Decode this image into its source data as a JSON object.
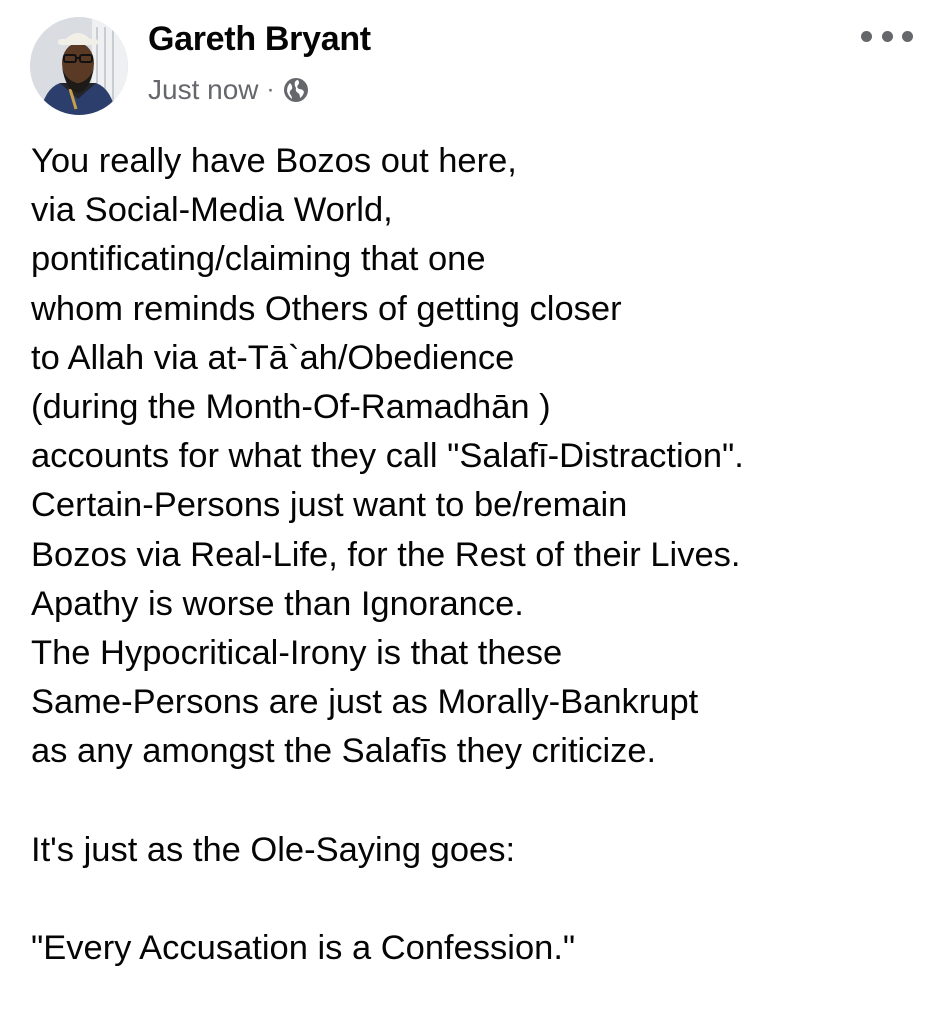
{
  "post": {
    "author": "Gareth Bryant",
    "timestamp": "Just now",
    "separator": "·",
    "privacy_icon": "globe-icon",
    "avatar": "profile-photo",
    "more_icon": "more-options-icon",
    "lines": [
      "You really have Bozos out here,",
      "via Social-Media World,",
      "pontificating/claiming that one",
      "whom reminds Others of getting closer",
      "to Allah via at-Tā`ah/Obedience",
      "(during the Month-Of-Ramadhān )",
      "accounts for what they call \"Salafī-Distraction\".",
      "Certain-Persons just want to be/remain",
      "Bozos via Real-Life, for the Rest of their Lives.",
      "Apathy is worse than Ignorance.",
      "The Hypocritical-Irony is that these",
      "Same-Persons are just as Morally-Bankrupt",
      "as any amongst the Salafīs they criticize.",
      "",
      "It's just as the Ole-Saying goes:",
      "",
      "\"Every Accusation is a Confession.\""
    ]
  },
  "colors": {
    "text": "#050505",
    "secondary_text": "#65676b",
    "background": "#ffffff"
  }
}
